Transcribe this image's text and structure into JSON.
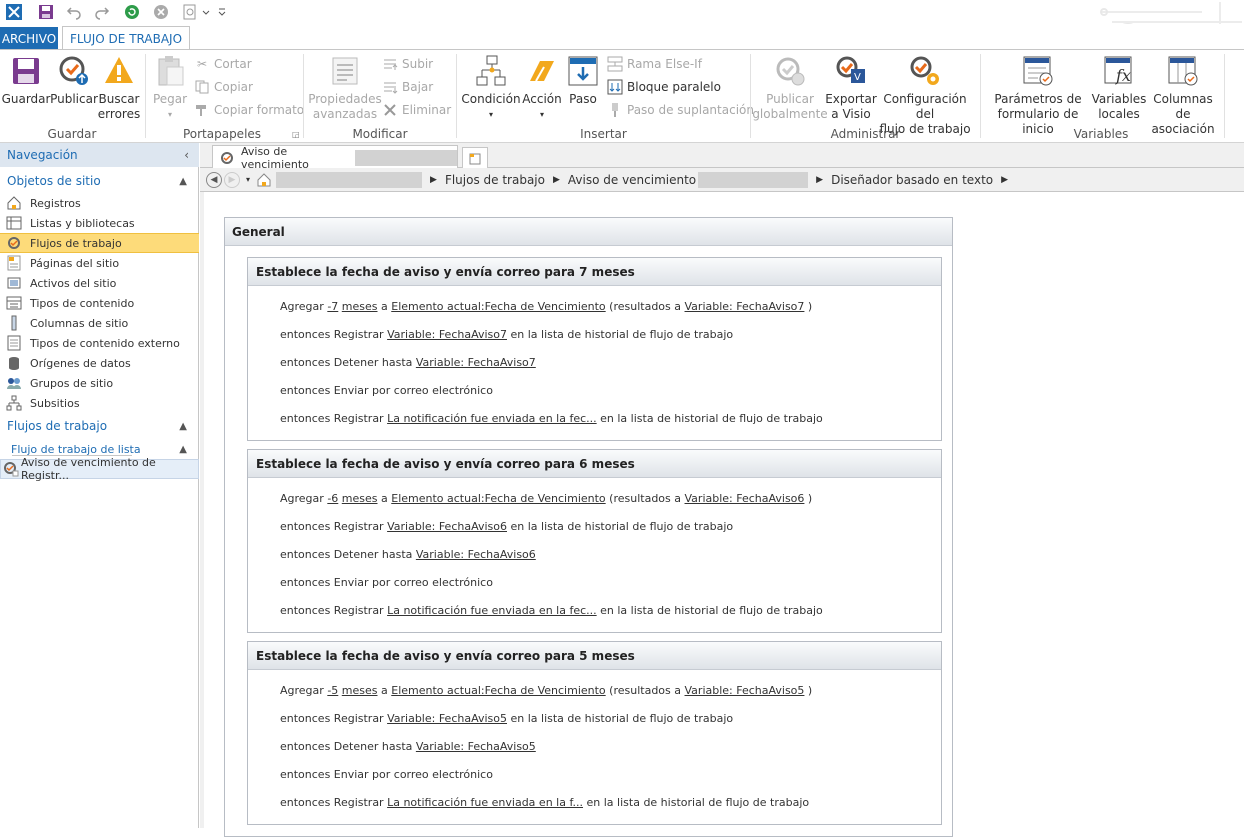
{
  "quick_access": {
    "icons": [
      "app-icon",
      "save-icon",
      "undo-icon",
      "redo-icon",
      "refresh-icon",
      "cancel-icon",
      "preview-icon",
      "customize-icon"
    ]
  },
  "ribbon_tabs": {
    "archivo": "ARCHIVO",
    "flujo": "FLUJO DE TRABAJO"
  },
  "ribbon": {
    "guardar": {
      "label": "Guardar",
      "group": "Guardar"
    },
    "publicar": "Publicar",
    "buscar_errores": "Buscar\nerrores",
    "pegar": "Pegar",
    "cortar": "Cortar",
    "copiar": "Copiar",
    "copiar_formato": "Copiar formato",
    "portapapeles": "Portapapeles",
    "propiedades": "Propiedades\navanzadas",
    "subir": "Subir",
    "bajar": "Bajar",
    "eliminar": "Eliminar",
    "modificar": "Modificar",
    "condicion": "Condición",
    "accion": "Acción",
    "paso": "Paso",
    "rama": "Rama Else-If",
    "bloque": "Bloque paralelo",
    "paso_suplantacion": "Paso de suplantación",
    "insertar": "Insertar",
    "publicar_glob": "Publicar\nglobalmente",
    "exportar": "Exportar\na Visio",
    "configuracion": "Configuración del\nflujo de trabajo",
    "administrar": "Administrar",
    "parametros": "Parámetros de\nformulario de inicio",
    "variables_locales": "Variables\nlocales",
    "columnas": "Columnas de\nasociación",
    "variables": "Variables"
  },
  "nav": {
    "header": "Navegación",
    "objetos": "Objetos de sitio",
    "items": [
      {
        "label": "Registros",
        "icon": "home-icon"
      },
      {
        "label": "Listas y bibliotecas",
        "icon": "list-icon"
      },
      {
        "label": "Flujos de trabajo",
        "icon": "workflow-icon"
      },
      {
        "label": "Páginas del sitio",
        "icon": "pages-icon"
      },
      {
        "label": "Activos del sitio",
        "icon": "assets-icon"
      },
      {
        "label": "Tipos de contenido",
        "icon": "content-type-icon"
      },
      {
        "label": "Columnas de sitio",
        "icon": "column-icon"
      },
      {
        "label": "Tipos de contenido externo",
        "icon": "external-icon"
      },
      {
        "label": "Orígenes de datos",
        "icon": "database-icon"
      },
      {
        "label": "Grupos de sitio",
        "icon": "group-icon"
      },
      {
        "label": "Subsitios",
        "icon": "subsite-icon"
      }
    ],
    "flujos": "Flujos de trabajo",
    "flujo_lista": "Flujo de trabajo de lista",
    "aviso": "Aviso de vencimiento de Registr..."
  },
  "doc_tab": {
    "title": "Aviso de vencimiento"
  },
  "breadcrumb": {
    "b1": "Flujos de trabajo",
    "b2": "Aviso de vencimiento",
    "b3": "Diseñador basado en texto"
  },
  "designer": {
    "general": "General",
    "steps": [
      {
        "title": "Establece la fecha de aviso y envía correo para 7 meses",
        "num": "-7",
        "var": "Variable: FechaAviso7",
        "note": "La notificación fue enviada en la fec..."
      },
      {
        "title": "Establece la fecha de aviso y envía correo para 6 meses",
        "num": "-6",
        "var": "Variable: FechaAviso6",
        "note": "La notificación fue enviada en la fec..."
      },
      {
        "title": "Establece la fecha de aviso y envía correo para 5 meses",
        "num": "-5",
        "var": "Variable: FechaAviso5",
        "note": "La notificación fue enviada en la f..."
      }
    ],
    "agregar": "Agregar",
    "meses": "meses",
    "a": "a",
    "elemento": "Elemento actual:Fecha de Vencimiento",
    "resultados": "(resultados a",
    "close_paren": ")",
    "entonces_registrar": "entonces Registrar",
    "en_lista": "en la lista de historial de flujo de trabajo",
    "entonces_detener": "entonces Detener hasta",
    "entonces_enviar": "entonces Enviar por correo electrónico"
  }
}
